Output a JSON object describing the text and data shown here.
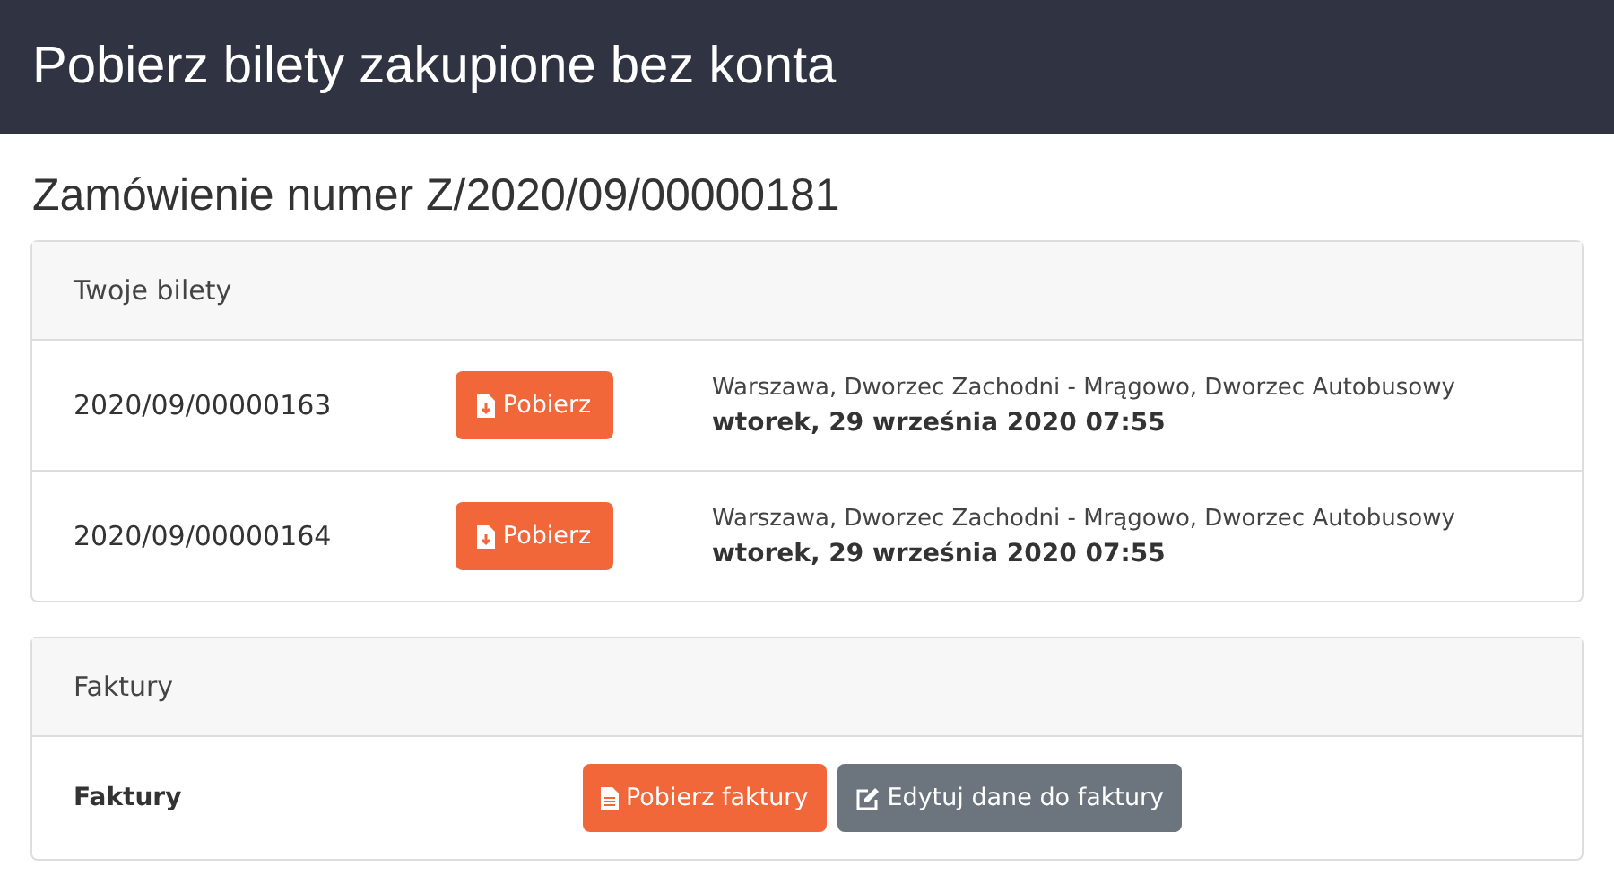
{
  "header": {
    "title": "Pobierz bilety zakupione bez konta"
  },
  "order_title": "Zamówienie numer Z/2020/09/00000181",
  "tickets_card": {
    "title": "Twoje bilety",
    "rows": [
      {
        "number": "2020/09/00000163",
        "button": "Pobierz",
        "route": "Warszawa, Dworzec Zachodni - Mrągowo, Dworzec Autobusowy",
        "date": "wtorek, 29 września 2020 07:55"
      },
      {
        "number": "2020/09/00000164",
        "button": "Pobierz",
        "route": "Warszawa, Dworzec Zachodni - Mrągowo, Dworzec Autobusowy",
        "date": "wtorek, 29 września 2020 07:55"
      }
    ]
  },
  "invoices_card": {
    "title": "Faktury",
    "label": "Faktury",
    "buttons": [
      {
        "label": "Pobierz faktury",
        "kind": "primary"
      },
      {
        "label": "Edytuj dane do faktury",
        "kind": "secondary"
      }
    ]
  }
}
